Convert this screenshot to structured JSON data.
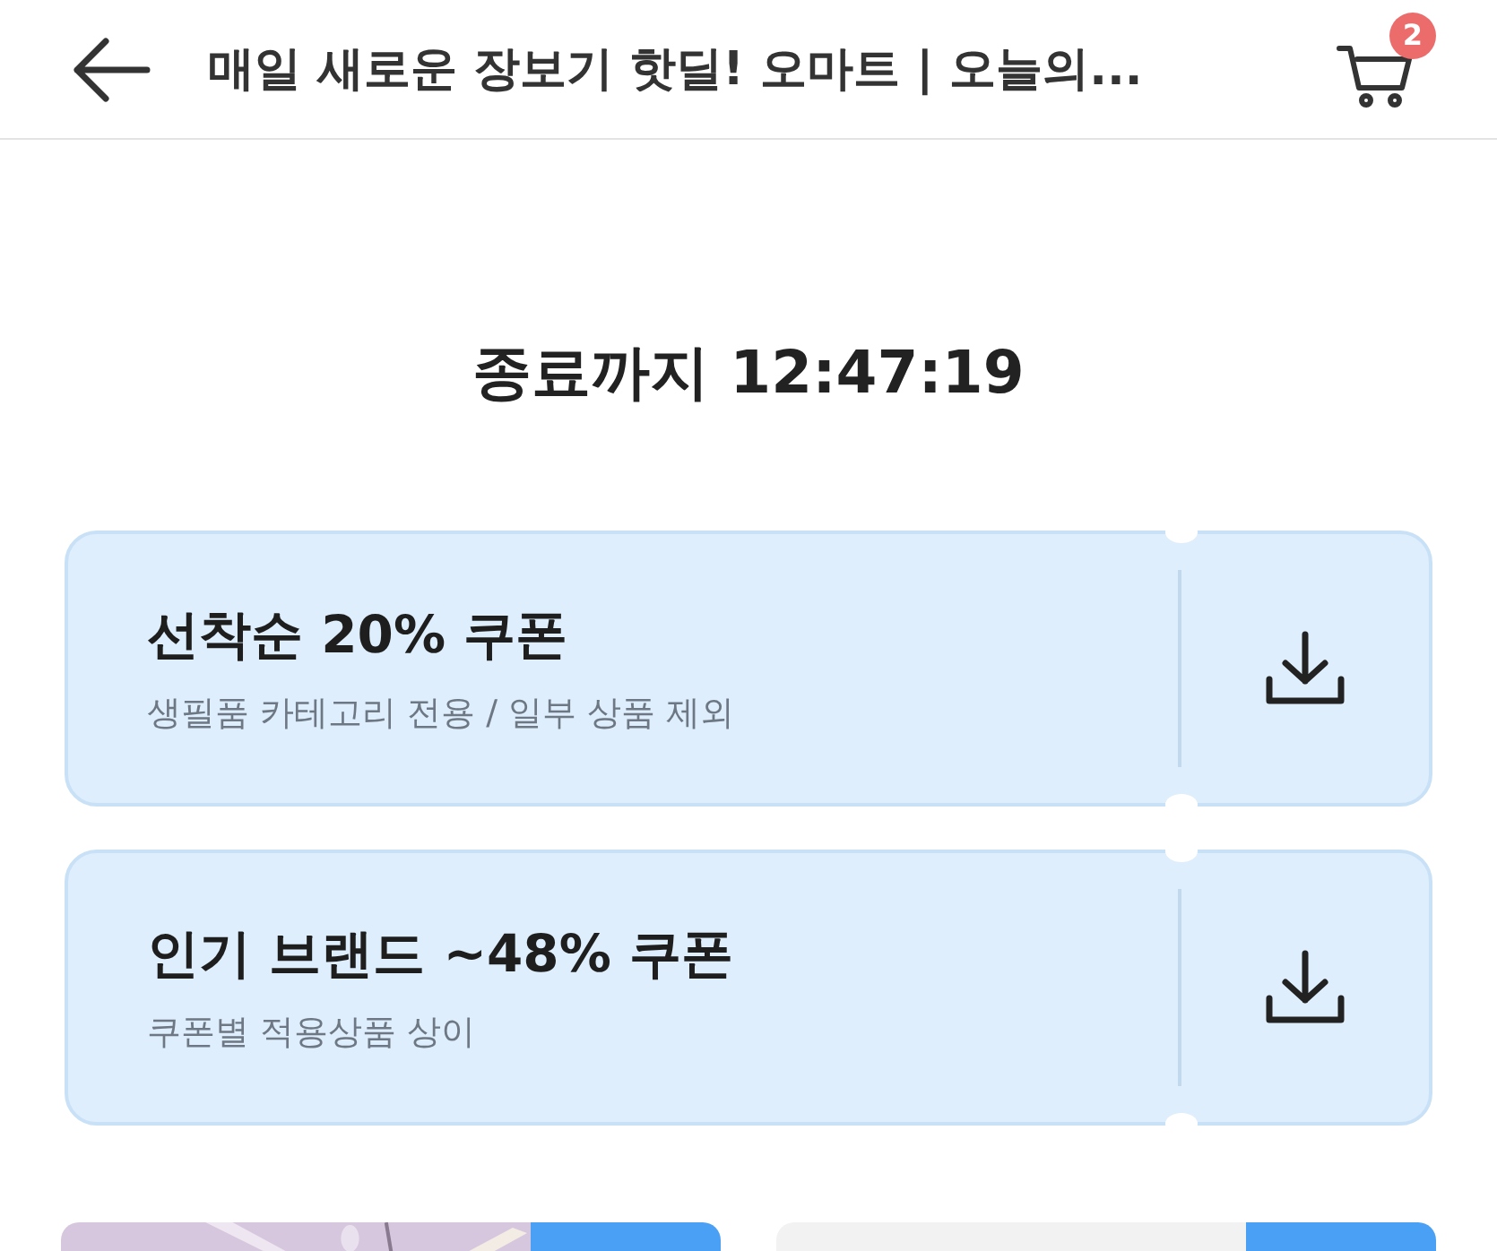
{
  "header": {
    "title": "매일 새로운 장보기 핫딜! 오마트 | 오늘의...",
    "cart_count": "2"
  },
  "countdown": {
    "label": "종료까지",
    "time": "12:47:19"
  },
  "coupons": [
    {
      "title": "선착순 20% 쿠폰",
      "subtitle": "생필품 카테고리 전용 / 일부 상품 제외"
    },
    {
      "title": "인기 브랜드 ~48% 쿠폰",
      "subtitle": "쿠폰별 적용상품 상이"
    }
  ],
  "products": [
    {
      "kind": "picture"
    },
    {
      "kind": "plain"
    }
  ]
}
